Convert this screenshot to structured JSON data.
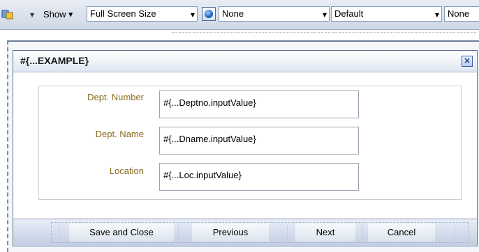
{
  "toolbar": {
    "show_label": "Show",
    "size_select": "Full Screen Size",
    "select_1": "None",
    "select_2": "Default",
    "select_3": "None"
  },
  "dialog": {
    "title": "#{...EXAMPLE}",
    "close_glyph": "×",
    "fields": [
      {
        "label": "Dept. Number",
        "value": "#{...Deptno.inputValue}"
      },
      {
        "label": "Dept. Name",
        "value": "#{...Dname.inputValue}"
      },
      {
        "label": "Location",
        "value": "#{...Loc.inputValue}"
      }
    ],
    "buttons": {
      "save_close": "Save and Close",
      "previous": "Previous",
      "next": "Next",
      "cancel": "Cancel"
    }
  },
  "icons": {
    "toolbar_left": "component-icon",
    "globe": "globe-icon",
    "close": "close-icon"
  },
  "colors": {
    "label": "#8a6a1f",
    "header_start": "#ffffff",
    "header_end": "#dfe6f1",
    "footer_end": "#bfcbe0"
  }
}
